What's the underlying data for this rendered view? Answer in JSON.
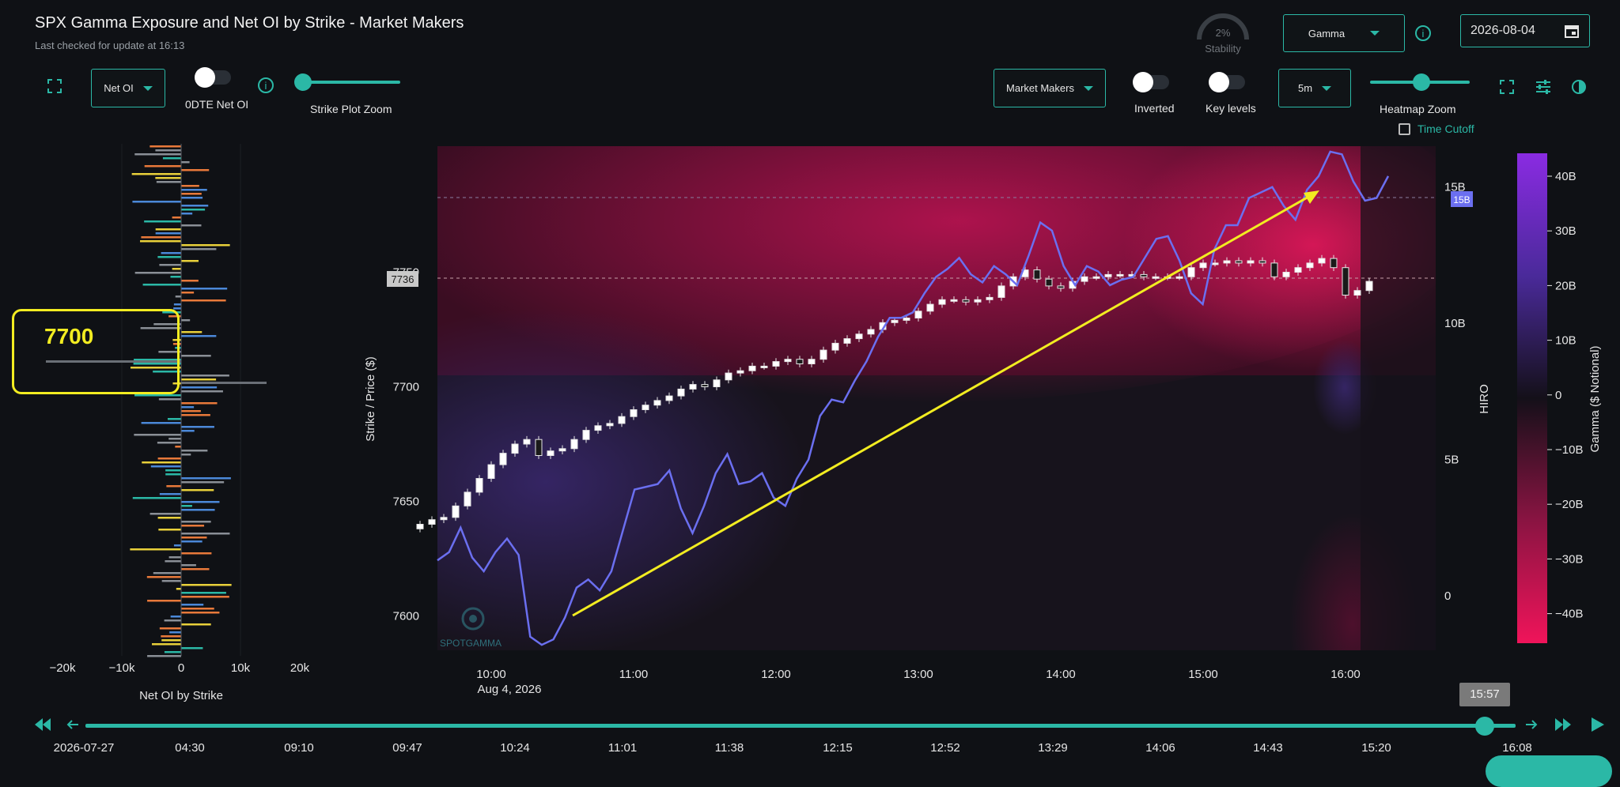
{
  "header": {
    "title": "SPX Gamma Exposure and Net OI by Strike - Market Makers",
    "subtitle": "Last checked for update at 16:13",
    "stability_value": "2%",
    "stability_label": "Stability",
    "metric_select": "Gamma",
    "date": "2026-08-04"
  },
  "left_controls": {
    "select": "Net OI",
    "toggle_label": "0DTE Net OI",
    "zoom_label": "Strike Plot Zoom"
  },
  "right_controls": {
    "participant_select": "Market Makers",
    "inverted_label": "Inverted",
    "key_levels_label": "Key levels",
    "interval_select": "5m",
    "zoom_label": "Heatmap Zoom",
    "time_cutoff_label": "Time Cutoff"
  },
  "net_oi_chart": {
    "xlabel": "Net OI by Strike",
    "ticks": [
      "−20k",
      "−10k",
      "0",
      "10k",
      "20k"
    ],
    "annotation_label": "7700"
  },
  "main_chart": {
    "ylabel": "Strike / Price ($)",
    "y_ticks": [
      "7750",
      "7700",
      "7650",
      "7600"
    ],
    "price_marker": "7736",
    "x_ticks": [
      "10:00",
      "11:00",
      "12:00",
      "13:00",
      "14:00",
      "15:00",
      "16:00"
    ],
    "x_date": "Aug 4, 2026",
    "hiro_label": "HIRO",
    "hiro_ticks": [
      "15B",
      "10B",
      "5B",
      "0"
    ],
    "hiro_marker": "15B",
    "watermark": "SPOTGAMMA"
  },
  "colorbar": {
    "label": "Gamma ($ Notional)",
    "ticks": [
      "40B",
      "30B",
      "20B",
      "10B",
      "0",
      "−10B",
      "−20B",
      "−30B",
      "−40B"
    ]
  },
  "timeline": {
    "current_time": "15:57",
    "labels": [
      "2026-07-27",
      "04:30",
      "09:10",
      "09:47",
      "10:24",
      "11:01",
      "11:38",
      "12:15",
      "12:52",
      "13:29",
      "14:06",
      "14:43",
      "15:20",
      "16:08"
    ]
  },
  "chart_data": {
    "type": "line",
    "title": "SPX Gamma Exposure and Net OI by Strike - Market Makers",
    "xlabel": "",
    "ylabel": "Strike / Price ($)",
    "ylim": [
      7585,
      7805
    ],
    "x": [
      "09:30",
      "09:35",
      "09:40",
      "09:45",
      "09:50",
      "09:55",
      "10:00",
      "10:05",
      "10:10",
      "10:15",
      "10:20",
      "10:25",
      "10:30",
      "10:35",
      "10:40",
      "10:45",
      "10:50",
      "10:55",
      "11:00",
      "11:05",
      "11:10",
      "11:15",
      "11:20",
      "11:25",
      "11:30",
      "11:35",
      "11:40",
      "11:45",
      "11:50",
      "11:55",
      "12:00",
      "12:05",
      "12:10",
      "12:15",
      "12:20",
      "12:25",
      "12:30",
      "12:35",
      "12:40",
      "12:45",
      "12:50",
      "12:55",
      "13:00",
      "13:05",
      "13:10",
      "13:15",
      "13:20",
      "13:25",
      "13:30",
      "13:35",
      "13:40",
      "13:45",
      "13:50",
      "13:55",
      "14:00",
      "14:05",
      "14:10",
      "14:15",
      "14:20",
      "14:25",
      "14:30",
      "14:35",
      "14:40",
      "14:45",
      "14:50",
      "14:55",
      "15:00",
      "15:05",
      "15:10",
      "15:15",
      "15:20",
      "15:25",
      "15:30",
      "15:35",
      "15:40",
      "15:45",
      "15:50",
      "15:55",
      "16:00",
      "16:05",
      "16:10"
    ],
    "series": [
      {
        "name": "",
        "values": [
          7640,
          7642,
          7643,
          7648,
          7654,
          7660,
          7666,
          7671,
          7675,
          7677,
          7670,
          7672,
          7673,
          7677,
          7681,
          7683,
          7684,
          7687,
          7690,
          7692,
          7694,
          7696,
          7699,
          7701,
          7700,
          7703,
          7706,
          7707,
          7709,
          7709,
          7711,
          7712,
          7710,
          7712,
          7716,
          7719,
          7721,
          7723,
          7725,
          7728,
          7729,
          7730,
          7733,
          7736,
          7738,
          7738,
          7737,
          7738,
          7739,
          7744,
          7748,
          7751,
          7747,
          7744,
          7743,
          7746,
          7748,
          7748,
          7749,
          7749,
          7749,
          7748,
          7748,
          7748,
          7748,
          7752,
          7754,
          7754,
          7755,
          7754,
          7755,
          7754,
          7748,
          7750,
          7752,
          7754,
          7756,
          7752,
          7740,
          7742,
          7746
        ]
      }
    ],
    "hiro": {
      "ylim": [
        -2,
        16.5
      ],
      "values": [
        1.3,
        1.6,
        2.5,
        1.4,
        0.9,
        1.6,
        2.1,
        1.5,
        -1.5,
        -1.8,
        -1.6,
        -0.8,
        0.3,
        0.6,
        0.2,
        0.9,
        2.4,
        3.9,
        4.0,
        4.1,
        4.6,
        3.2,
        2.3,
        3.3,
        4.5,
        5.2,
        4.1,
        4.2,
        4.5,
        3.6,
        3.3,
        4.3,
        5.0,
        6.6,
        7.2,
        7.1,
        7.9,
        8.6,
        9.5,
        10.2,
        10.2,
        10.4,
        11.1,
        11.7,
        12.0,
        12.4,
        11.8,
        11.5,
        12.1,
        11.8,
        11.4,
        12.5,
        13.7,
        13.4,
        12.1,
        11.4,
        12.1,
        11.9,
        11.4,
        11.6,
        11.7,
        12.4,
        13.1,
        13.2,
        12.3,
        11.1,
        10.7,
        12.7,
        13.6,
        13.6,
        14.6,
        14.8,
        15.0,
        14.3,
        13.8,
        14.9,
        15.4,
        16.3,
        16.2,
        15.2,
        14.5,
        14.6,
        15.4
      ]
    }
  }
}
